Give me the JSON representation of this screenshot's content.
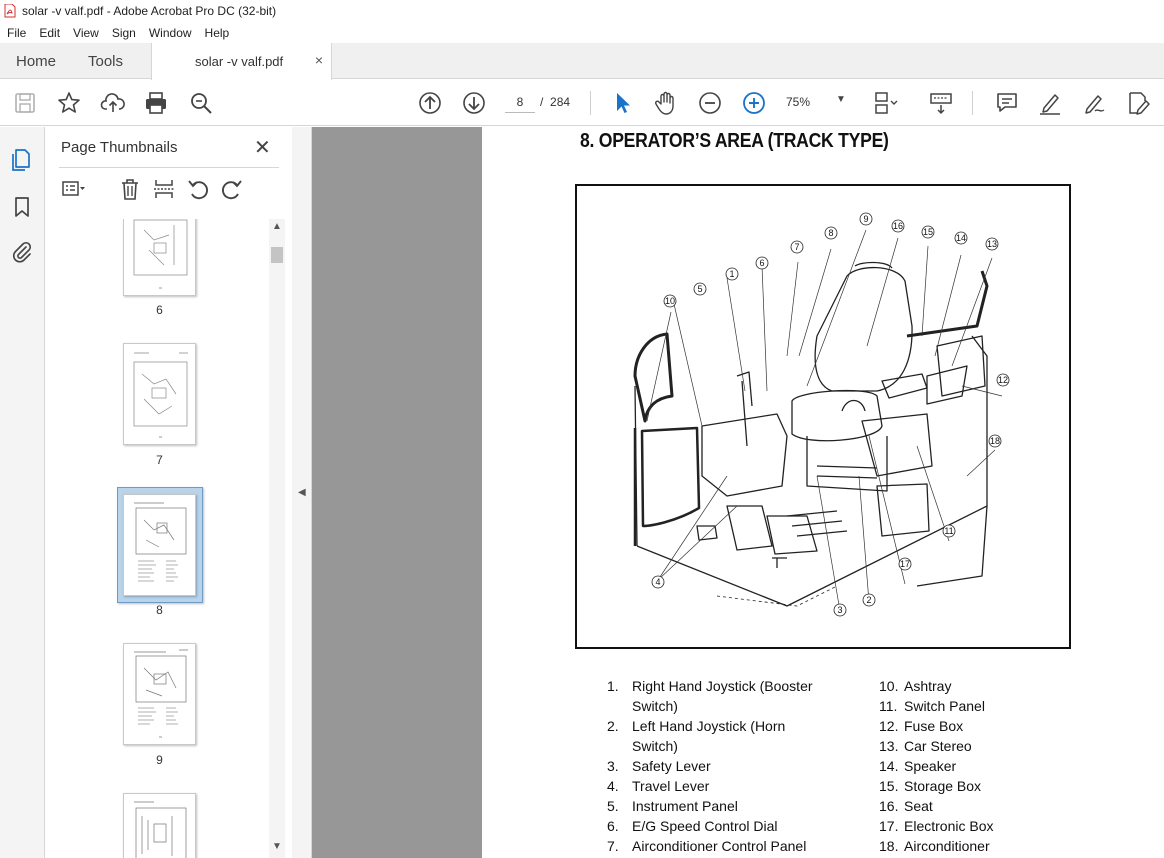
{
  "window": {
    "title": "solar -v valf.pdf - Adobe Acrobat Pro DC (32-bit)"
  },
  "menu": [
    "File",
    "Edit",
    "View",
    "Sign",
    "Window",
    "Help"
  ],
  "tabs": {
    "home": "Home",
    "tools": "Tools",
    "document": "solar -v valf.pdf",
    "close_glyph": "×"
  },
  "toolbar": {
    "current_page": "8",
    "page_separator": "/",
    "total_pages": "284",
    "zoom": "75%",
    "icons_left": [
      "save-icon",
      "star-icon",
      "share-upload-icon",
      "print-icon",
      "search-zoom-icon"
    ],
    "icons_nav": [
      "prev-page-icon",
      "next-page-icon"
    ],
    "icons_view": [
      "select-cursor-icon",
      "hand-pan-icon",
      "zoom-out-icon",
      "zoom-in-icon"
    ],
    "icons_right": [
      "page-display-icon",
      "scroll-mode-icon",
      "comment-icon",
      "highlight-pen-icon",
      "sign-pen-icon",
      "fill-sign-icon"
    ]
  },
  "thumbnails": {
    "title": "Page Thumbnails",
    "close_glyph": "✕",
    "pages": [
      {
        "label": "6",
        "selected": false
      },
      {
        "label": "7",
        "selected": false
      },
      {
        "label": "8",
        "selected": true
      },
      {
        "label": "9",
        "selected": false
      },
      {
        "label": "",
        "selected": false
      }
    ]
  },
  "document": {
    "heading": "8. OPERATOR’S AREA (TRACK TYPE)",
    "figure_callouts": [
      "1",
      "2",
      "3",
      "4",
      "5",
      "6",
      "7",
      "8",
      "9",
      "10",
      "11",
      "12",
      "13",
      "14",
      "15",
      "16",
      "17",
      "18"
    ],
    "legend_left": [
      {
        "num": "1.",
        "text": "Right Hand Joystick (Booster"
      },
      {
        "num": "",
        "text": "Switch)"
      },
      {
        "num": "2.",
        "text": "Left Hand Joystick (Horn"
      },
      {
        "num": "",
        "text": "Switch)"
      },
      {
        "num": "3.",
        "text": "Safety Lever"
      },
      {
        "num": "4.",
        "text": "Travel Lever"
      },
      {
        "num": "5.",
        "text": "Instrument Panel"
      },
      {
        "num": "6.",
        "text": "E/G Speed Control Dial"
      },
      {
        "num": "7.",
        "text": "Airconditioner Control Panel"
      }
    ],
    "legend_right": [
      {
        "num": "10.",
        "text": "Ashtray"
      },
      {
        "num": "11.",
        "text": "Switch Panel"
      },
      {
        "num": "12.",
        "text": "Fuse Box"
      },
      {
        "num": "13.",
        "text": "Car Stereo"
      },
      {
        "num": "14.",
        "text": "Speaker"
      },
      {
        "num": "15.",
        "text": "Storage Box"
      },
      {
        "num": "16.",
        "text": "Seat"
      },
      {
        "num": "17.",
        "text": "Electronic Box"
      },
      {
        "num": "18.",
        "text": "Airconditioner"
      }
    ]
  },
  "colors": {
    "accent_blue": "#1a73c9",
    "workspace_gray": "#979797",
    "selected_thumb": "#b9d3ea",
    "pdf_icon_red": "#d32f2f"
  }
}
